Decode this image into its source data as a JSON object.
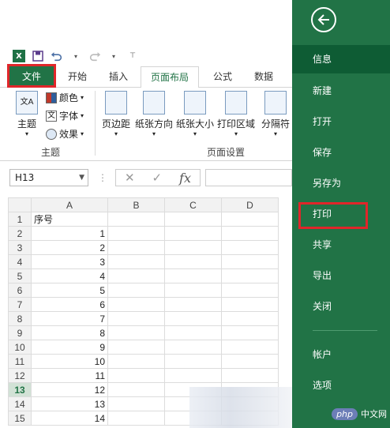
{
  "qat": {
    "excel_logo": "X"
  },
  "tabs": [
    "文件",
    "开始",
    "插入",
    "页面布局",
    "公式",
    "数据"
  ],
  "ribbon": {
    "theme_group": {
      "theme": "主题",
      "colors": "颜色",
      "fonts": "字体",
      "effects": "效果",
      "label": "主题"
    },
    "page_setup": {
      "margins": "页边距",
      "orientation": "纸张方向",
      "size": "纸张大小",
      "print_area": "打印区域",
      "breaks": "分隔符",
      "label": "页面设置"
    }
  },
  "formula_bar": {
    "namebox": "H13",
    "fx": "fx"
  },
  "grid": {
    "columns": [
      "A",
      "B",
      "C",
      "D"
    ],
    "rows": [
      {
        "n": "1",
        "a": "序号"
      },
      {
        "n": "2",
        "a": "1"
      },
      {
        "n": "3",
        "a": "2"
      },
      {
        "n": "4",
        "a": "3"
      },
      {
        "n": "5",
        "a": "4"
      },
      {
        "n": "6",
        "a": "5"
      },
      {
        "n": "7",
        "a": "6"
      },
      {
        "n": "8",
        "a": "7"
      },
      {
        "n": "9",
        "a": "8"
      },
      {
        "n": "10",
        "a": "9"
      },
      {
        "n": "11",
        "a": "10"
      },
      {
        "n": "12",
        "a": "11"
      },
      {
        "n": "13",
        "a": "12"
      },
      {
        "n": "14",
        "a": "13"
      },
      {
        "n": "15",
        "a": "14"
      }
    ],
    "selected_row": "13"
  },
  "backstage": {
    "items": [
      "信息",
      "新建",
      "打开",
      "保存",
      "另存为",
      "打印",
      "共享",
      "导出",
      "关闭",
      "帐户",
      "选项"
    ],
    "active": "信息"
  },
  "watermark": {
    "logo": "php",
    "text": "中文网"
  },
  "colors": {
    "excel_green": "#217346",
    "highlight_red": "#e0262a"
  }
}
